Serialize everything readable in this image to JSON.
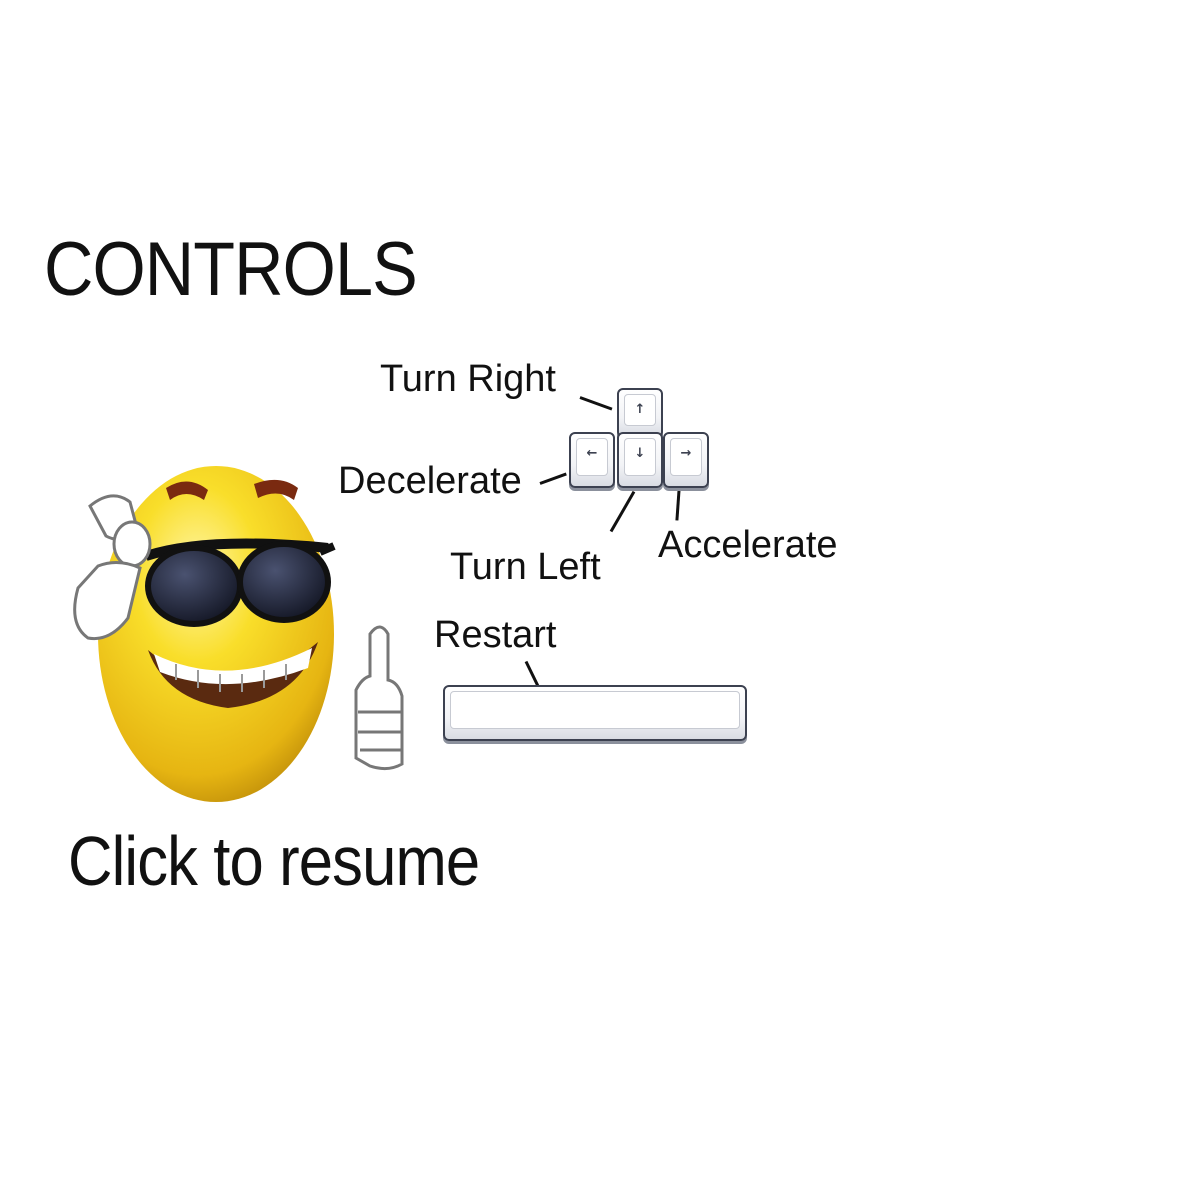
{
  "screen": {
    "title": "CONTROLS",
    "resume_prompt": "Click to resume"
  },
  "controls": {
    "turn_right": "Turn Right",
    "decelerate": "Decelerate",
    "turn_left": "Turn Left",
    "accelerate": "Accelerate",
    "restart": "Restart"
  },
  "keys": {
    "up": "↑",
    "left": "←",
    "down": "↓",
    "right": "→",
    "space": ""
  },
  "icons": {
    "mascot": "sunglasses-thumbs-up-smiley-icon"
  },
  "colors": {
    "smiley_yellow": "#f4d21c",
    "smiley_shadow": "#c99a0a",
    "lens": "#1e2233",
    "key_outline": "#3c4150"
  }
}
